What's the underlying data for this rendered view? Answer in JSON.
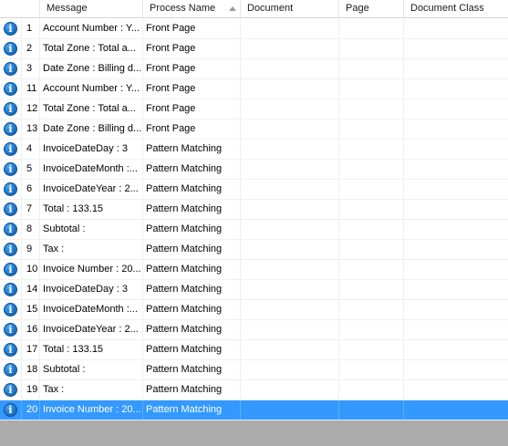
{
  "columns": {
    "message": "Message",
    "process_name": "Process Name",
    "document": "Document",
    "page": "Page",
    "document_class": "Document Class"
  },
  "icon": "info-icon",
  "icon_glyph": "i",
  "rows": [
    {
      "num": "1",
      "message": "Account Number : Y...",
      "process": "Front Page",
      "document": "",
      "page": "",
      "document_class": ""
    },
    {
      "num": "2",
      "message": "Total Zone : Total a...",
      "process": "Front Page",
      "document": "",
      "page": "",
      "document_class": ""
    },
    {
      "num": "3",
      "message": "Date Zone : Billing d...",
      "process": "Front Page",
      "document": "",
      "page": "",
      "document_class": ""
    },
    {
      "num": "11",
      "message": "Account Number : Y...",
      "process": "Front Page",
      "document": "",
      "page": "",
      "document_class": ""
    },
    {
      "num": "12",
      "message": "Total Zone : Total a...",
      "process": "Front Page",
      "document": "",
      "page": "",
      "document_class": ""
    },
    {
      "num": "13",
      "message": "Date Zone : Billing d...",
      "process": "Front Page",
      "document": "",
      "page": "",
      "document_class": ""
    },
    {
      "num": "4",
      "message": "InvoiceDateDay : 3",
      "process": "Pattern Matching",
      "document": "",
      "page": "",
      "document_class": ""
    },
    {
      "num": "5",
      "message": "InvoiceDateMonth :...",
      "process": "Pattern Matching",
      "document": "",
      "page": "",
      "document_class": ""
    },
    {
      "num": "6",
      "message": "InvoiceDateYear : 2...",
      "process": "Pattern Matching",
      "document": "",
      "page": "",
      "document_class": ""
    },
    {
      "num": "7",
      "message": "Total : 133.15",
      "process": "Pattern Matching",
      "document": "",
      "page": "",
      "document_class": ""
    },
    {
      "num": "8",
      "message": "Subtotal :",
      "process": "Pattern Matching",
      "document": "",
      "page": "",
      "document_class": ""
    },
    {
      "num": "9",
      "message": "Tax :",
      "process": "Pattern Matching",
      "document": "",
      "page": "",
      "document_class": ""
    },
    {
      "num": "10",
      "message": "Invoice Number : 20...",
      "process": "Pattern Matching",
      "document": "",
      "page": "",
      "document_class": ""
    },
    {
      "num": "14",
      "message": "InvoiceDateDay : 3",
      "process": "Pattern Matching",
      "document": "",
      "page": "",
      "document_class": ""
    },
    {
      "num": "15",
      "message": "InvoiceDateMonth :...",
      "process": "Pattern Matching",
      "document": "",
      "page": "",
      "document_class": ""
    },
    {
      "num": "16",
      "message": "InvoiceDateYear : 2...",
      "process": "Pattern Matching",
      "document": "",
      "page": "",
      "document_class": ""
    },
    {
      "num": "17",
      "message": "Total : 133.15",
      "process": "Pattern Matching",
      "document": "",
      "page": "",
      "document_class": ""
    },
    {
      "num": "18",
      "message": "Subtotal :",
      "process": "Pattern Matching",
      "document": "",
      "page": "",
      "document_class": ""
    },
    {
      "num": "19",
      "message": "Tax :",
      "process": "Pattern Matching",
      "document": "",
      "page": "",
      "document_class": ""
    },
    {
      "num": "20",
      "message": "Invoice Number : 20...",
      "process": "Pattern Matching",
      "document": "",
      "page": "",
      "document_class": ""
    }
  ],
  "selected_row": 19,
  "colors": {
    "selection": "#3399ff",
    "icon": "#1a72c6",
    "empty_area": "#ababab"
  }
}
